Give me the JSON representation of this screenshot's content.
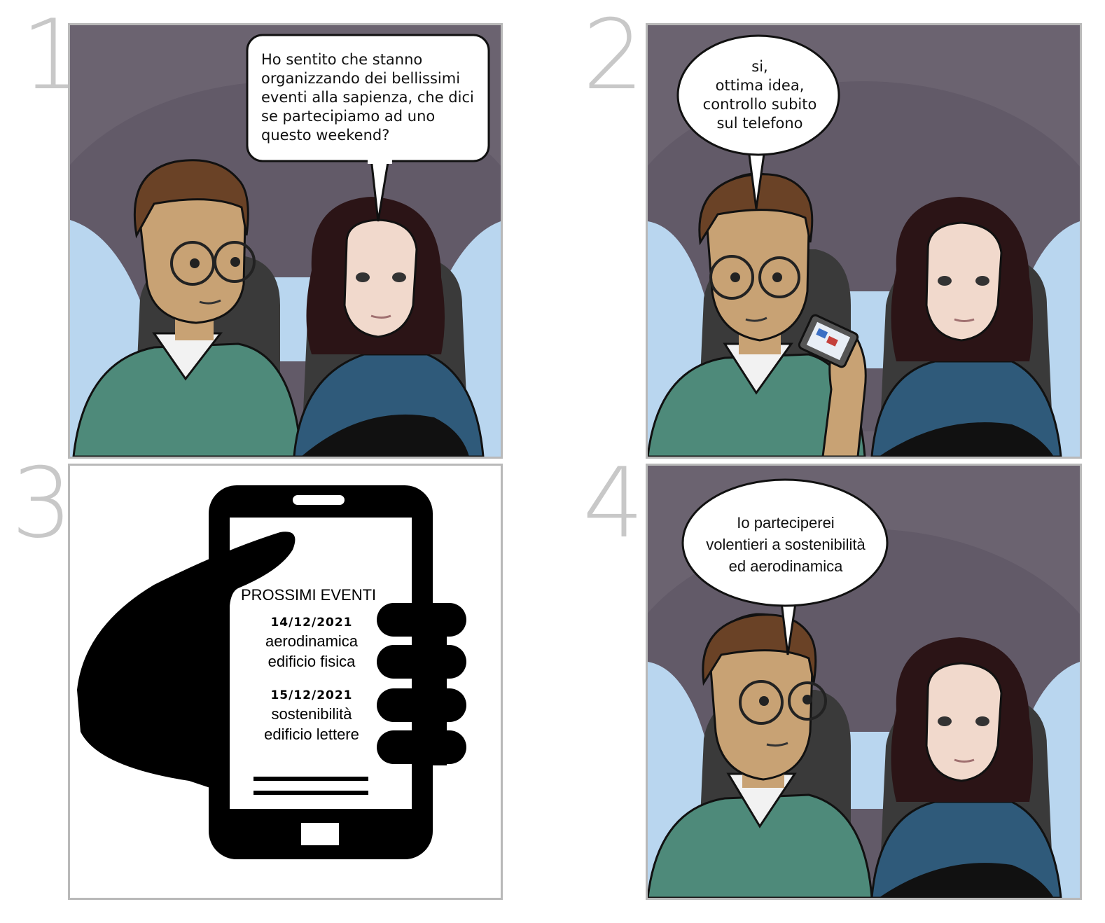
{
  "panel_numbers": [
    "1",
    "2",
    "3",
    "4"
  ],
  "panel1": {
    "bubble_text": "Ho sentito che stanno organizzando dei bellissimi eventi alla sapienza, che dici se partecipiamo ad uno questo weekend?"
  },
  "panel2": {
    "bubble_lines": [
      "si,",
      "ottima idea,",
      "controllo subito",
      "sul telefono"
    ]
  },
  "panel3": {
    "title": "PROSSIMI EVENTI",
    "events": [
      {
        "date": "14/12/2021",
        "name": "aerodinamica",
        "place": "edificio fisica"
      },
      {
        "date": "15/12/2021",
        "name": "sostenibilità",
        "place": "edificio lettere"
      }
    ]
  },
  "panel4": {
    "bubble_lines": [
      "Io parteciperei",
      "volentieri a sostenibilità",
      "ed aerodinamica"
    ]
  },
  "colors": {
    "car_interior": "#6b6370",
    "window_blue": "#b9d6ef",
    "sweater_green": "#4e8a7a",
    "sweater_blue": "#2f5a7a",
    "hair_brown": "#6a4226",
    "hair_dark": "#2b1416",
    "skin_man": "#c8a274",
    "skin_woman": "#f1d9cc"
  }
}
